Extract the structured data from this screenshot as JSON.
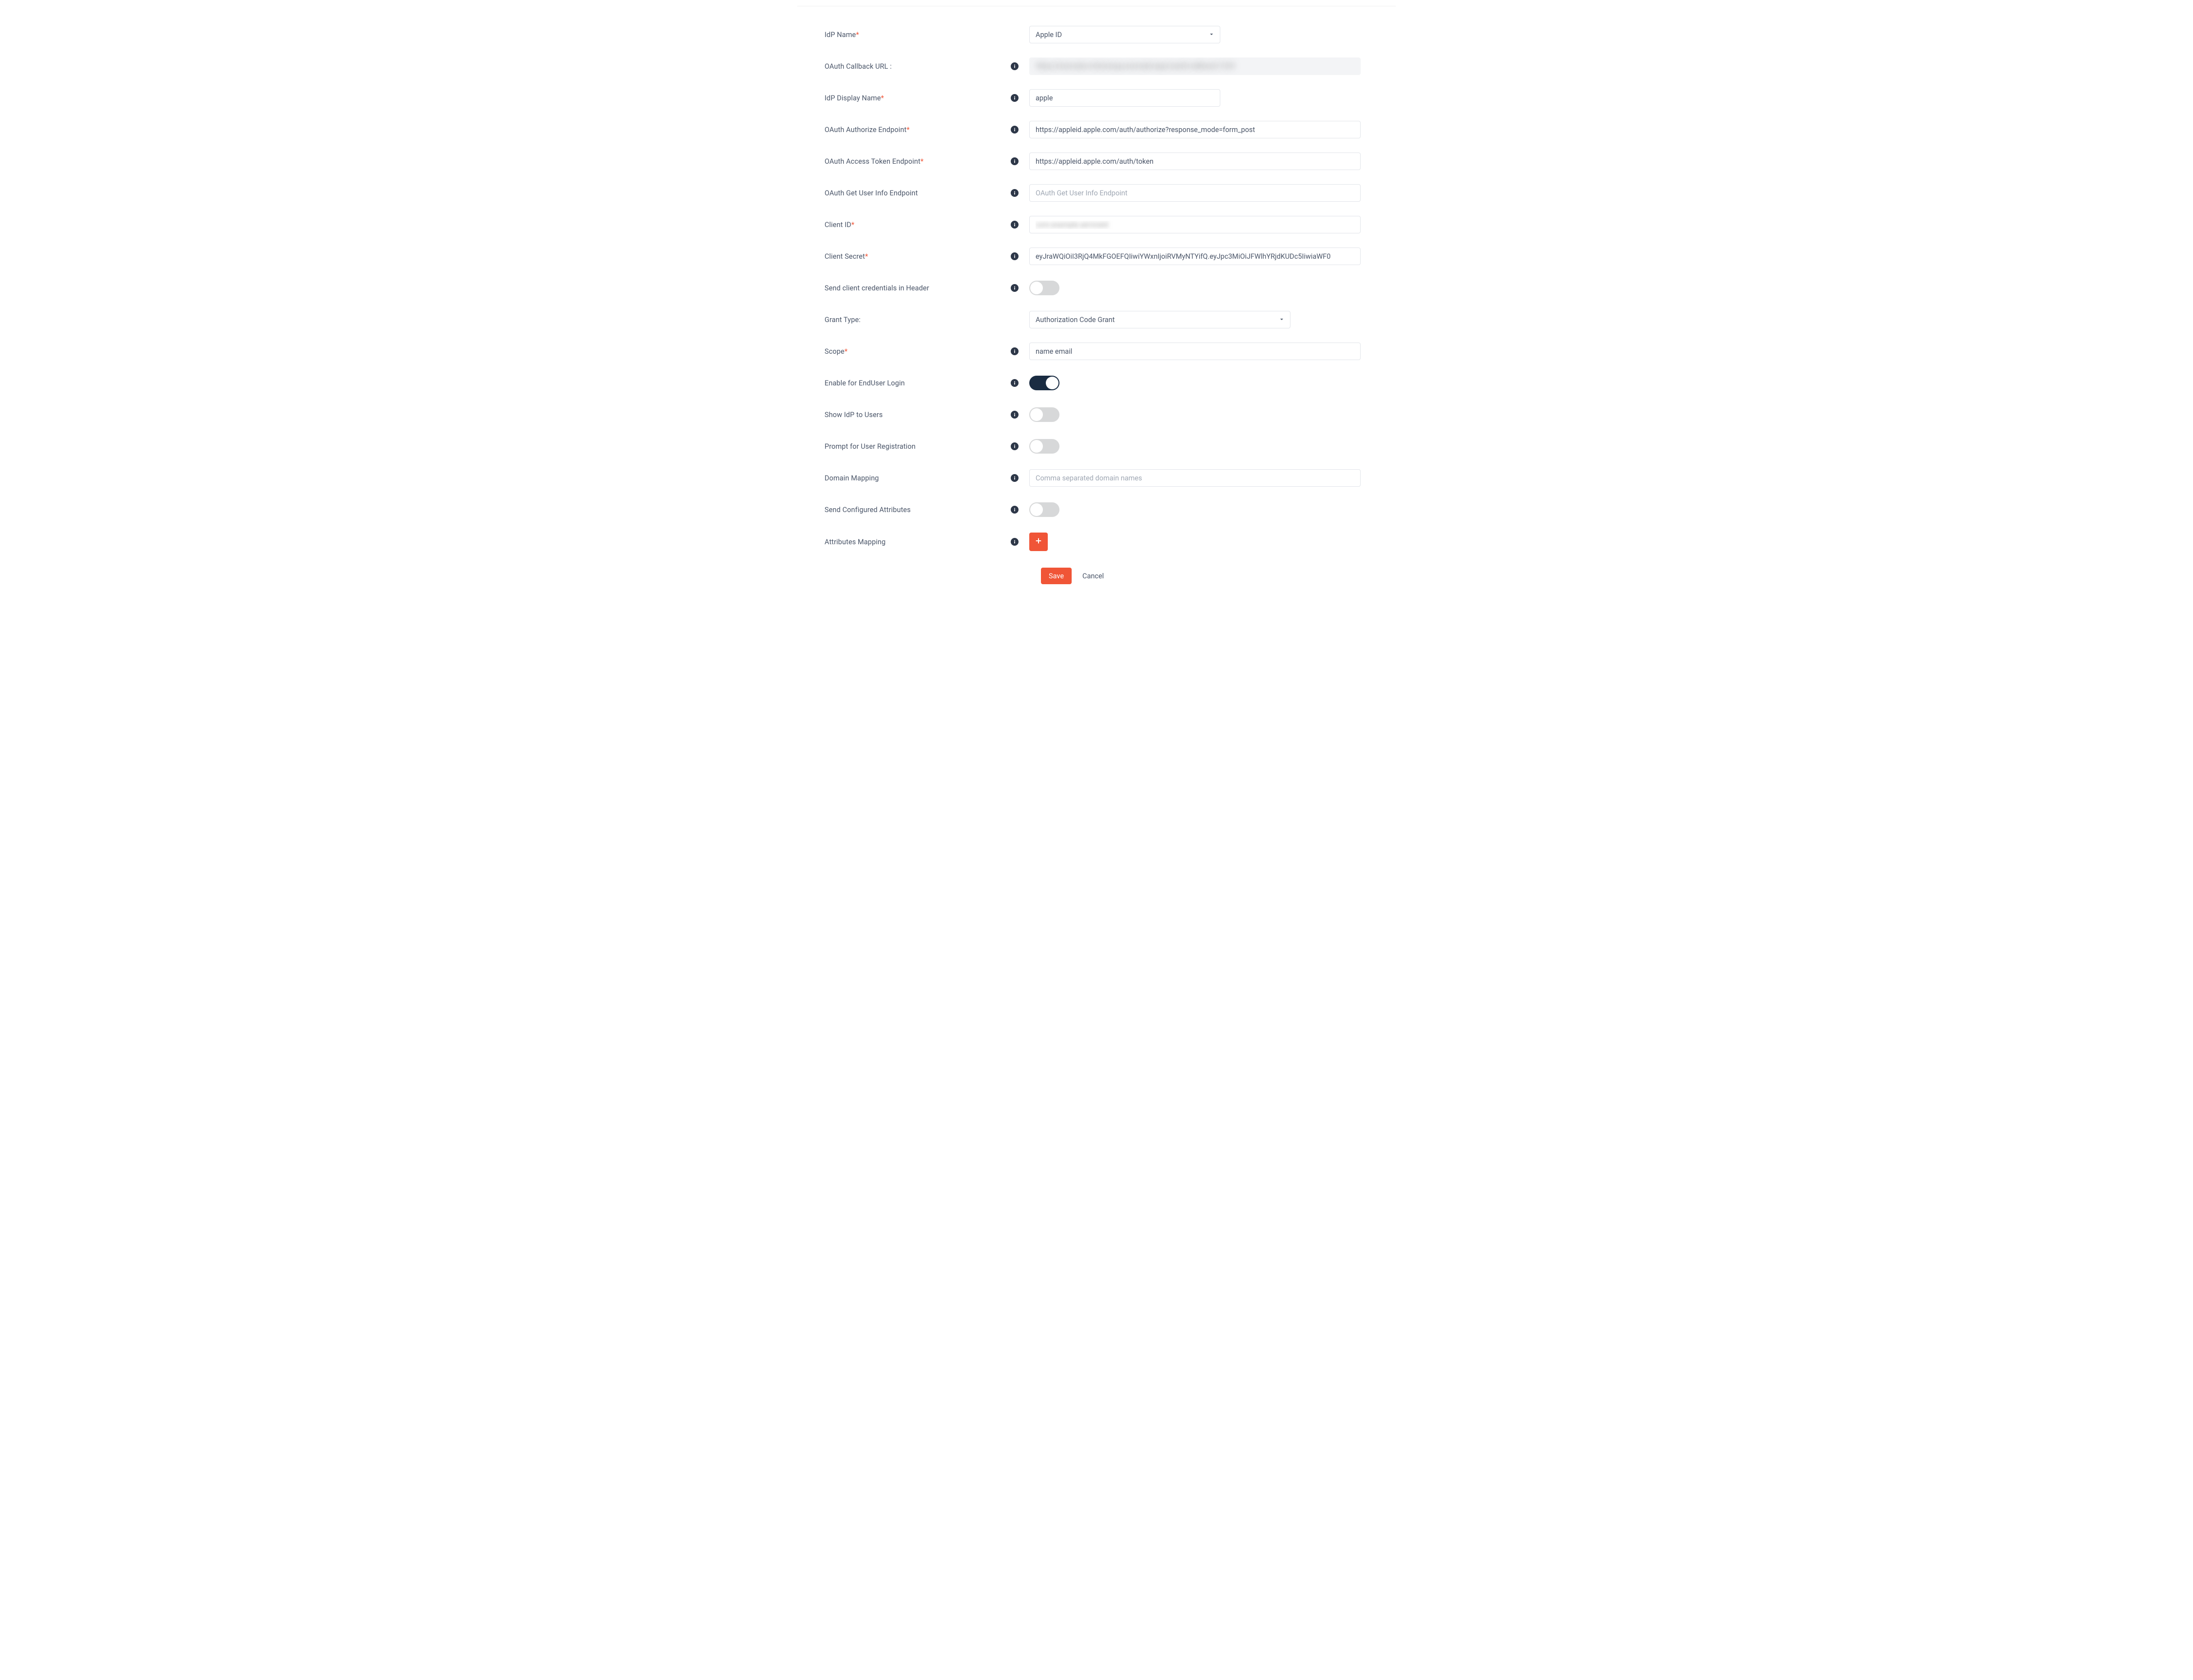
{
  "fields": {
    "idp_name": {
      "label": "IdP Name",
      "required": true,
      "options": [
        "Apple ID"
      ],
      "value": "Apple ID"
    },
    "callback_url": {
      "label": "OAuth Callback URL :",
      "value": "https://example.miniorange.example/app/oauth/callback/1234"
    },
    "display_name": {
      "label": "IdP Display Name",
      "required": true,
      "value": "apple"
    },
    "authorize_endpoint": {
      "label": "OAuth Authorize Endpoint",
      "required": true,
      "value": "https://appleid.apple.com/auth/authorize?response_mode=form_post"
    },
    "token_endpoint": {
      "label": "OAuth Access Token Endpoint",
      "required": true,
      "value": "https://appleid.apple.com/auth/token"
    },
    "userinfo_endpoint": {
      "label": "OAuth Get User Info Endpoint",
      "placeholder": "OAuth Get User Info Endpoint",
      "value": ""
    },
    "client_id": {
      "label": "Client ID",
      "required": true,
      "value": "com.example.serviceid"
    },
    "client_secret": {
      "label": "Client Secret",
      "required": true,
      "value": "eyJraWQiOiI3RjQ4MkFGOEFQIiwiYWxnIjoiRVMyNTYifQ.eyJpc3MiOiJFWlhYRjdKUDc5IiwiaWF0"
    },
    "send_in_header": {
      "label": "Send client credentials in Header",
      "on": false
    },
    "grant_type": {
      "label": "Grant Type:",
      "options": [
        "Authorization Code Grant"
      ],
      "value": "Authorization Code Grant"
    },
    "scope": {
      "label": "Scope",
      "required": true,
      "value": "name email"
    },
    "enable_enduser": {
      "label": "Enable for EndUser Login",
      "on": true
    },
    "show_idp": {
      "label": "Show IdP to Users",
      "on": false
    },
    "prompt_registration": {
      "label": "Prompt for User Registration",
      "on": false
    },
    "domain_mapping": {
      "label": "Domain Mapping",
      "placeholder": "Comma separated domain names",
      "value": ""
    },
    "send_configured_attrs": {
      "label": "Send Configured Attributes",
      "on": false
    },
    "attributes_mapping": {
      "label": "Attributes Mapping"
    }
  },
  "actions": {
    "save": "Save",
    "cancel": "Cancel"
  }
}
